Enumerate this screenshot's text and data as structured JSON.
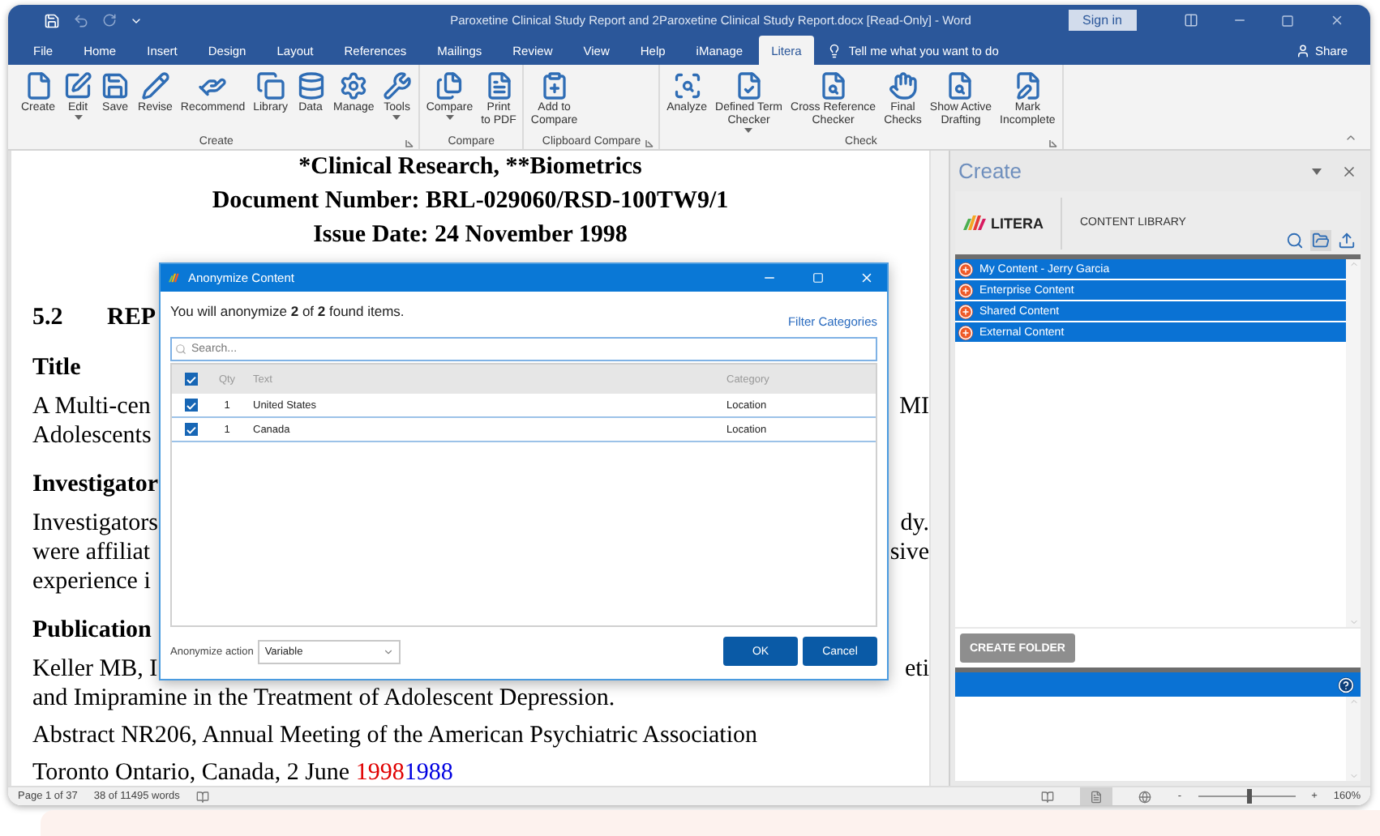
{
  "window": {
    "title": "Paroxetine Clinical Study Report and 2Paroxetine Clinical Study Report.docx [Read-Only]  -  Word",
    "sign_in": "Sign in"
  },
  "menu_tabs": [
    {
      "label": "File",
      "selected": false
    },
    {
      "label": "Home",
      "selected": false
    },
    {
      "label": "Insert",
      "selected": false
    },
    {
      "label": "Design",
      "selected": false
    },
    {
      "label": "Layout",
      "selected": false
    },
    {
      "label": "References",
      "selected": false
    },
    {
      "label": "Mailings",
      "selected": false
    },
    {
      "label": "Review",
      "selected": false
    },
    {
      "label": "View",
      "selected": false
    },
    {
      "label": "Help",
      "selected": false
    },
    {
      "label": "iManage",
      "selected": false
    },
    {
      "label": "Litera",
      "selected": true
    }
  ],
  "tell_me": "Tell me what you want to do",
  "share": "Share",
  "ribbon": {
    "groups": [
      {
        "label": "Create",
        "launcher": true,
        "buttons": [
          {
            "lines": [
              "Create"
            ],
            "menu": false
          },
          {
            "lines": [
              "Edit"
            ],
            "menu": true
          },
          {
            "lines": [
              "Save"
            ],
            "menu": false
          },
          {
            "lines": [
              "Revise"
            ],
            "menu": false
          },
          {
            "lines": [
              "Recommend"
            ],
            "menu": false
          },
          {
            "lines": [
              "Library"
            ],
            "menu": false
          },
          {
            "lines": [
              "Data"
            ],
            "menu": false
          },
          {
            "lines": [
              "Manage"
            ],
            "menu": false
          },
          {
            "lines": [
              "Tools"
            ],
            "menu": true
          }
        ]
      },
      {
        "label": "Compare",
        "launcher": false,
        "buttons": [
          {
            "lines": [
              "Compare"
            ],
            "menu": true
          },
          {
            "lines": [
              "Print",
              "to PDF"
            ],
            "menu": false
          }
        ]
      },
      {
        "label": "Clipboard Compare",
        "launcher": true,
        "buttons": [
          {
            "lines": [
              "Add to",
              "Compare"
            ],
            "menu": false
          }
        ]
      },
      {
        "label": "Check",
        "launcher": true,
        "buttons": [
          {
            "lines": [
              "Analyze"
            ],
            "menu": false
          },
          {
            "lines": [
              "Defined Term",
              "Checker"
            ],
            "menu": true
          },
          {
            "lines": [
              "Cross Reference",
              "Checker"
            ],
            "menu": false
          },
          {
            "lines": [
              "Final",
              "Checks"
            ],
            "menu": false
          },
          {
            "lines": [
              "Show Active",
              "Drafting"
            ],
            "menu": false
          },
          {
            "lines": [
              "Mark",
              "Incomplete"
            ],
            "menu": false
          }
        ]
      }
    ]
  },
  "document": {
    "header_lines": [
      "*Clinical Research, **Biometrics",
      "Document Number: BRL-029060/RSD-100TW9/1",
      "Issue Date: 24 November 1998"
    ],
    "lines": [
      {
        "kind": "section",
        "number": "5.2",
        "left": "REP"
      },
      {
        "kind": "heading",
        "left": "Title"
      },
      {
        "kind": "para",
        "left": "A Multi-cen",
        "right": "MI"
      },
      {
        "kind": "cont",
        "left": "Adolescents"
      },
      {
        "kind": "heading",
        "left": "Investigator"
      },
      {
        "kind": "para",
        "left": "Investigators",
        "right": "dy."
      },
      {
        "kind": "cont",
        "left": "were affiliat",
        "right": "sive"
      },
      {
        "kind": "cont",
        "left": "experience i"
      },
      {
        "kind": "heading",
        "left": "Publication"
      },
      {
        "kind": "para",
        "left": "Keller MB, I",
        "right": "eti"
      },
      {
        "kind": "cont",
        "left": "and Imipramine in the Treatment of Adolescent Depression."
      },
      {
        "kind": "para",
        "left": "Abstract NR206, Annual Meeting of the American Psychiatric Association"
      },
      {
        "kind": "para",
        "left": "Toronto Ontario, Canada, 2 June ",
        "deleted": "1998",
        "inserted": "1988"
      }
    ]
  },
  "dialog": {
    "title": "Anonymize Content",
    "summary": "You will anonymize **2** of **2** found items.",
    "filter_link": "Filter Categories",
    "search_placeholder": "Search...",
    "header_checked": true,
    "columns": [
      "Qty",
      "Text",
      "Category"
    ],
    "rows": [
      {
        "checked": true,
        "qty": "1",
        "text": "United States",
        "category": "Location"
      },
      {
        "checked": true,
        "qty": "1",
        "text": "Canada",
        "category": "Location"
      }
    ],
    "action_label": "Anonymize action",
    "action_value": "Variable",
    "buttons": [
      "OK",
      "Cancel"
    ]
  },
  "task_pane": {
    "title": "Create",
    "logo_text": "LITERA",
    "section": "CONTENT LIBRARY",
    "items": [
      "My Content - Jerry Garcia",
      "Enterprise Content",
      "Shared Content",
      "External Content"
    ],
    "create_folder": {
      "label": "CREATE FOLDER",
      "disabled": true
    }
  },
  "status_bar": {
    "page": "Page 1 of 37",
    "words": "38 of 11495 words",
    "views": [
      {
        "selected": false
      },
      {
        "selected": true
      },
      {
        "selected": false
      }
    ],
    "zoom_minus": "-",
    "zoom_plus": "+",
    "zoom": {
      "level": 0.52
    },
    "zoom_reading": "160%"
  }
}
